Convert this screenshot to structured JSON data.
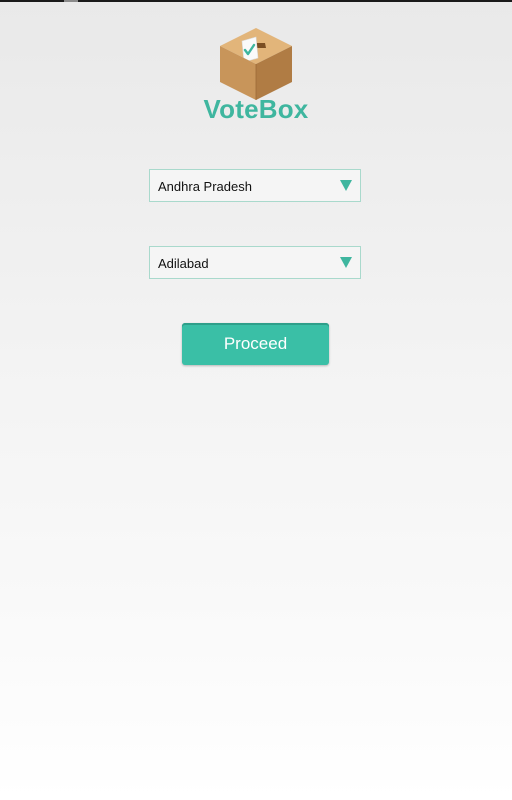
{
  "app": {
    "name": "VoteBox",
    "logo_icon": "ballot-box-icon"
  },
  "form": {
    "state_select": {
      "selected": "Andhra Pradesh",
      "arrow_icon": "dropdown-arrow-icon"
    },
    "district_select": {
      "selected": "Adilabad",
      "arrow_icon": "dropdown-arrow-icon"
    },
    "proceed_label": "Proceed"
  },
  "colors": {
    "accent": "#3fb69f",
    "button": "#3abfa6",
    "spinner_border": "#a9d9cc"
  }
}
